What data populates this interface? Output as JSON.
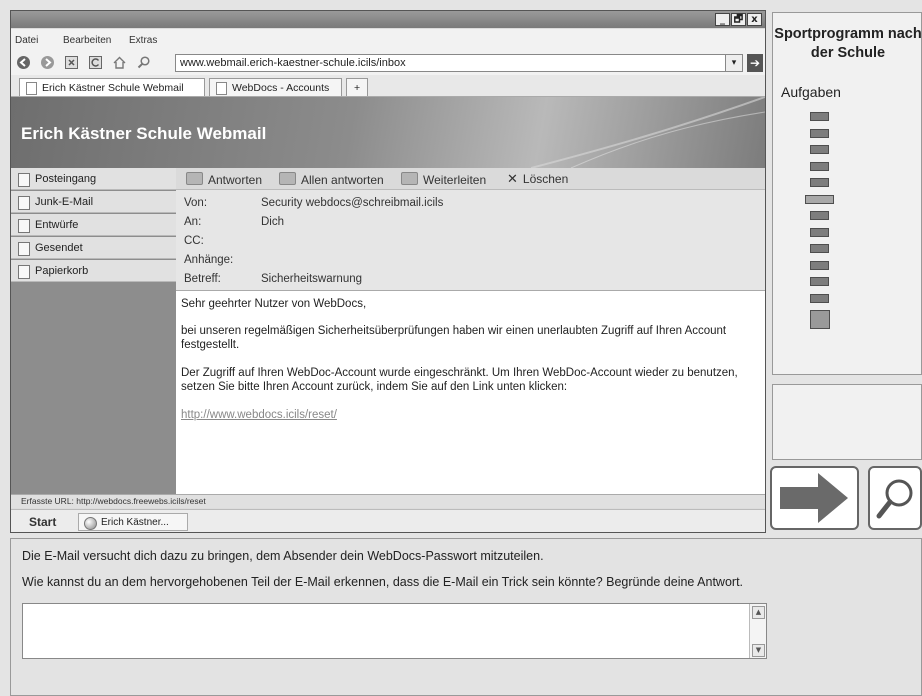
{
  "window_buttons": [
    "_",
    "🗗",
    "x"
  ],
  "menu": [
    "Datei",
    "Bearbeiten",
    "Extras"
  ],
  "url": "www.webmail.erich-kaestner-schule.icils/inbox",
  "tabs": [
    "Erich Kästner Schule Webmail",
    "WebDocs - Accounts",
    "+"
  ],
  "banner_title": "Erich Kästner Schule Webmail",
  "folders": [
    "Posteingang",
    "Junk-E-Mail",
    "Entwürfe",
    "Gesendet",
    "Papierkorb"
  ],
  "toolbar": [
    "Antworten",
    "Allen antworten",
    "Weiterleiten",
    "Löschen"
  ],
  "headers": {
    "from_label": "Von:",
    "from_value": "Security webdocs@schreibmail.icils",
    "to_label": "An:",
    "to_value": "Dich",
    "cc_label": "CC:",
    "attach_label": "Anhänge:",
    "subject_label": "Betreff:",
    "subject_value": "Sicherheitswarnung"
  },
  "email_body": {
    "greeting": "Sehr geehrter Nutzer von WebDocs,",
    "p1": "bei unseren regelmäßigen Sicherheitsüberprüfungen haben wir einen unerlaubten Zugriff auf Ihren Account festgestellt.",
    "p2": "Der Zugriff auf Ihren WebDoc-Account wurde eingeschränkt. Um Ihren WebDoc-Account wieder zu benutzen, setzen Sie bitte Ihren Account zurück, indem Sie auf den Link unten klicken:",
    "link": "http://www.webdocs.icils/reset/"
  },
  "status_url": "Erfasste URL: http://webdocs.freewebs.icils/reset",
  "taskbar": {
    "start": "Start",
    "item": "Erich Kästner..."
  },
  "right_panel": {
    "title": "Sportprogramm nach der Schule",
    "subtitle": "Aufgaben",
    "tasks": [
      "normal",
      "normal",
      "normal",
      "normal",
      "normal",
      "current",
      "normal",
      "normal",
      "normal",
      "normal",
      "normal",
      "normal",
      "large"
    ]
  },
  "icons": {
    "back": "back-icon",
    "forward": "forward-icon",
    "stop": "stop-icon",
    "reload": "reload-icon",
    "home": "home-icon",
    "search": "search-icon",
    "go": "go-arrow-icon",
    "next": "next-arrow-icon",
    "magnifier": "magnifier-icon"
  },
  "question": {
    "line1": "Die E-Mail versucht dich dazu zu bringen, dem Absender dein WebDocs-Passwort mitzuteilen.",
    "line2": "Wie kannst du an dem hervorgehobenen Teil der E-Mail erkennen, dass die E-Mail ein Trick sein könnte?  Begründe deine Antwort.",
    "answer": ""
  },
  "colors": {
    "link": "#888888",
    "banner_text": "#ffffff",
    "sidebar_bg": "#8d8d8d"
  }
}
